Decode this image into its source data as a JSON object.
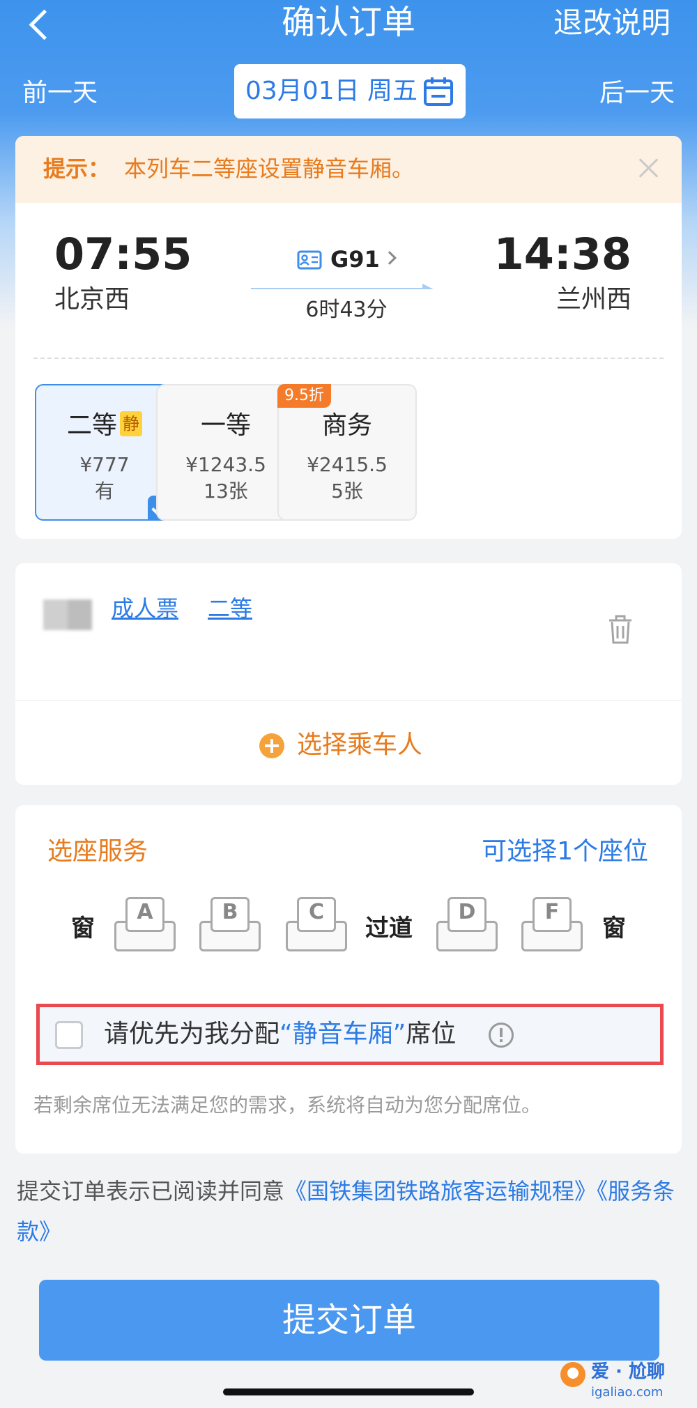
{
  "nav": {
    "title": "确认订单",
    "right_link": "退改说明"
  },
  "date_bar": {
    "prev_label": "前一天",
    "date": "03月01日 周五",
    "next_label": "后一天"
  },
  "notice": {
    "label": "提示：",
    "text": "本列车二等座设置静音车厢。"
  },
  "train": {
    "dep_time": "07:55",
    "dep_station": "北京西",
    "number": "G91",
    "duration": "6时43分",
    "arr_time": "14:38",
    "arr_station": "兰州西"
  },
  "seat_classes": [
    {
      "name": "二等",
      "badge": "静",
      "price": "¥777",
      "availability": "有",
      "selected": true
    },
    {
      "name": "一等",
      "price": "¥1243.5",
      "availability": "13张"
    },
    {
      "name": "商务",
      "discount": "9.5折",
      "price": "¥2415.5",
      "availability": "5张"
    }
  ],
  "passenger": {
    "ticket_type": "成人票",
    "seat_class": "二等",
    "add_label": "选择乘车人"
  },
  "seat_service": {
    "title": "选座服务",
    "count_text": "可选择1个座位",
    "window_label": "窗",
    "aisle_label": "过道",
    "seats": [
      "A",
      "B",
      "C",
      "D",
      "F"
    ],
    "quiet_pref": {
      "prefix": "请优先为我分配",
      "highlight": "“静音车厢”",
      "suffix": "席位"
    },
    "note": "若剩余席位无法满足您的需求，系统将自动为您分配席位。"
  },
  "agreement": {
    "prefix": "提交订单表示已阅读并同意",
    "link1": "《国铁集团铁路旅客运输规程》",
    "link2": "《服务条款》"
  },
  "submit_label": "提交订单",
  "watermark": {
    "text": "爱 · 尬聊",
    "url": "igaliao.com"
  },
  "colors": {
    "primary": "#3d8ee8",
    "accent": "#e77b1d",
    "alert_border": "#e84a4f"
  }
}
